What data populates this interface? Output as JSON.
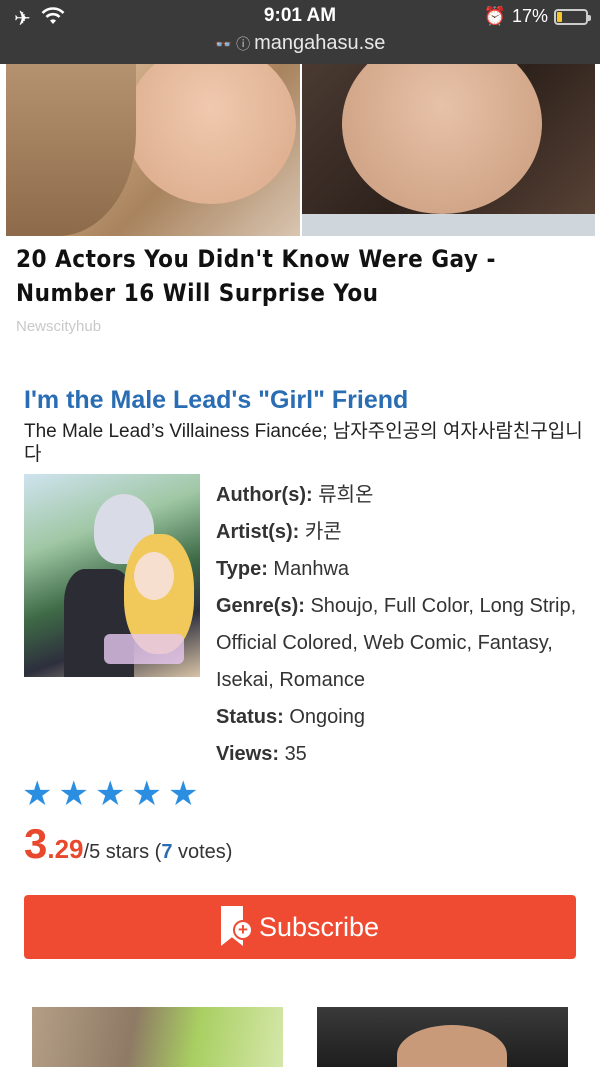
{
  "status_bar": {
    "time": "9:01 AM",
    "battery": "17%",
    "battery_level": 0.17,
    "url": "mangahasu.se",
    "icons": [
      "airplane-icon",
      "wifi-icon",
      "alarm-icon",
      "battery-icon",
      "reader-icon",
      "info-icon"
    ]
  },
  "ad": {
    "headline": "20 Actors You Didn't Know Were Gay - Number 16 Will Surprise You",
    "source": "Newscityhub"
  },
  "manga": {
    "title": "I'm the Male Lead's \"Girl\" Friend",
    "alt_title": "The Male Lead’s Villainess Fiancée; 남자주인공의 여자사람친구입니다",
    "details": {
      "author_label": "Author(s):",
      "author": "류희온",
      "artist_label": "Artist(s):",
      "artist": "카콘",
      "type_label": "Type:",
      "type": "Manhwa",
      "genre_label": "Genre(s):",
      "genres": "Shoujo, Full Color, Long Strip, Official Colored, Web Comic, Fantasy, Isekai, Romance",
      "status_label": "Status:",
      "status": "Ongoing",
      "views_label": "Views:",
      "views": "35"
    },
    "rating": {
      "stars": 5,
      "score_int": "3",
      "score_dec": ".29",
      "out_of": "/5 stars (",
      "votes": "7",
      "votes_suffix": " votes)"
    },
    "subscribe_label": "Subscribe"
  },
  "colors": {
    "title_blue": "#2a6db3",
    "accent_red": "#ef4b32",
    "star_blue": "#2b8ee0"
  }
}
